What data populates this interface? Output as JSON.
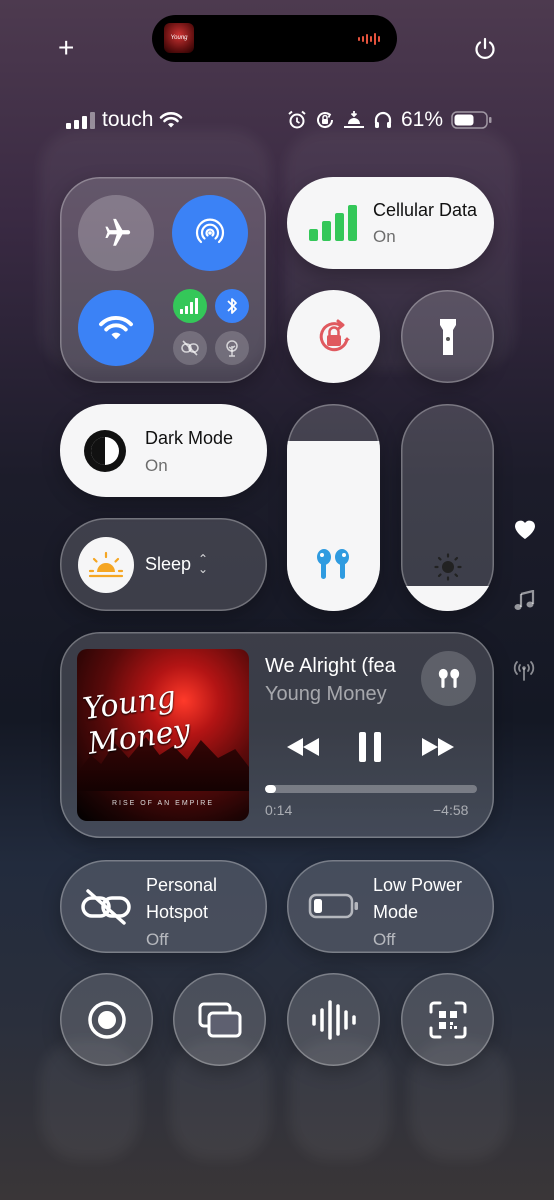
{
  "top": {
    "add_label": "+",
    "now_playing_art_text": "Young Money",
    "power_icon": "power-icon"
  },
  "status": {
    "carrier": "touch",
    "battery": "61%"
  },
  "connectivity": {
    "airplane_icon": "airplane-icon",
    "airdrop_icon": "airdrop-icon",
    "wifi_icon": "wifi-icon",
    "cellular_icon": "cellular-icon",
    "bluetooth_icon": "bluetooth-icon",
    "link_off_icon": "link-off-icon",
    "tree_icon": "tree-icon"
  },
  "cellular": {
    "title": "Cellular Data",
    "state": "On"
  },
  "dark_mode": {
    "title": "Dark Mode",
    "state": "On"
  },
  "sleep": {
    "title": "Sleep",
    "chevron": "⌃⌄"
  },
  "volume_level": 0.82,
  "brightness_level": 0.12,
  "music": {
    "title": "We Alright (fea",
    "artist": "Young Money",
    "album_script": "Young Money",
    "album_caption": "RISE OF AN EMPIRE",
    "elapsed": "0:14",
    "remaining": "−4:58",
    "progress": 0.05
  },
  "hotspot": {
    "title1": "Personal",
    "title2": "Hotspot",
    "state": "Off"
  },
  "low_power": {
    "title1": "Low Power",
    "title2": "Mode",
    "state": "Off"
  },
  "side": {
    "heart_icon": "heart-icon",
    "music_icon": "music-note-icon",
    "antenna_icon": "antenna-icon"
  },
  "colors": {
    "accent_blue": "#3b82f6",
    "green": "#34c759",
    "red": "#e0595f"
  }
}
